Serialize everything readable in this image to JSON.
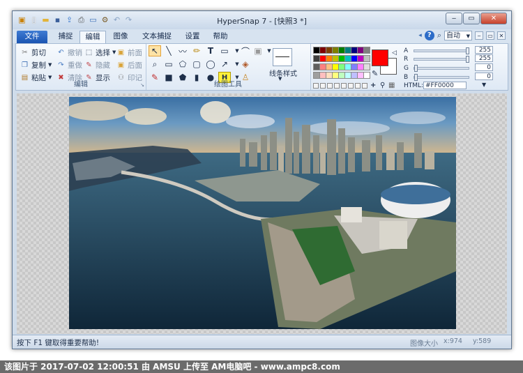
{
  "window": {
    "title": "HyperSnap 7 - [快照3 *]",
    "controls": {
      "minimize": "‒",
      "maximize": "▭",
      "close": "✕"
    }
  },
  "quick_access": [
    "app-logo-icon",
    "new-file-icon",
    "open-folder-icon",
    "save-icon",
    "upload-icon",
    "print-icon",
    "window-icon",
    "settings-icon",
    "undo-icon",
    "redo-icon"
  ],
  "tabs": [
    {
      "label": "文件"
    },
    {
      "label": "捕捉"
    },
    {
      "label": "编辑"
    },
    {
      "label": "图像"
    },
    {
      "label": "文本捕捉"
    },
    {
      "label": "设置"
    },
    {
      "label": "帮助"
    }
  ],
  "ribbon_right": {
    "zoom_value": "自动"
  },
  "edit_group": {
    "label": "编辑",
    "cut": "剪切",
    "copy": "复制",
    "paste": "粘贴",
    "undo": "撤销",
    "redo": "重做",
    "clear": "清除",
    "select": "选择",
    "hide": "隐藏",
    "show": "显示",
    "front": "前面",
    "back": "后面",
    "stamp": "印记"
  },
  "draw_group": {
    "label": "绘图工具",
    "line_style": "线条样式"
  },
  "palette": {
    "selected_color": "#FF0000",
    "background_color": "#FFFFFF",
    "swatches": [
      [
        "#000000",
        "#7f0000",
        "#7f3f00",
        "#7f7f00",
        "#007f00",
        "#007f7f",
        "#00007f",
        "#7f007f",
        "#7f7f7f"
      ],
      [
        "#3f3f3f",
        "#ff0000",
        "#ff7f00",
        "#bfbf00",
        "#00bf00",
        "#00bfbf",
        "#0000ff",
        "#bf00bf",
        "#bfbfbf"
      ],
      [
        "#5f5f5f",
        "#ff7f7f",
        "#ffbf7f",
        "#ffff00",
        "#7fff7f",
        "#7fffff",
        "#7f7fff",
        "#ff7fff",
        "#dfdfdf"
      ],
      [
        "#9f9f9f",
        "#ffbfbf",
        "#ffdfbf",
        "#ffff7f",
        "#bfffbf",
        "#bfffff",
        "#bfbfff",
        "#ffbfff",
        "#ffffff"
      ]
    ]
  },
  "color_sliders": [
    {
      "label": "A",
      "value": "255"
    },
    {
      "label": "R",
      "value": "255"
    },
    {
      "label": "G",
      "value": "0"
    },
    {
      "label": "B",
      "value": "0"
    }
  ],
  "html_color": {
    "label": "HTML:",
    "value": "#FF0000"
  },
  "status": {
    "message": "按下 F1 键取得重要帮助!",
    "image_size_label": "图像大小",
    "x": "x:974",
    "y": "y:589"
  },
  "footer_text": "该图片于 2017-07-02 12:00:51 由 AMSU 上传至 AM电脑吧 - www.ampc8.com"
}
